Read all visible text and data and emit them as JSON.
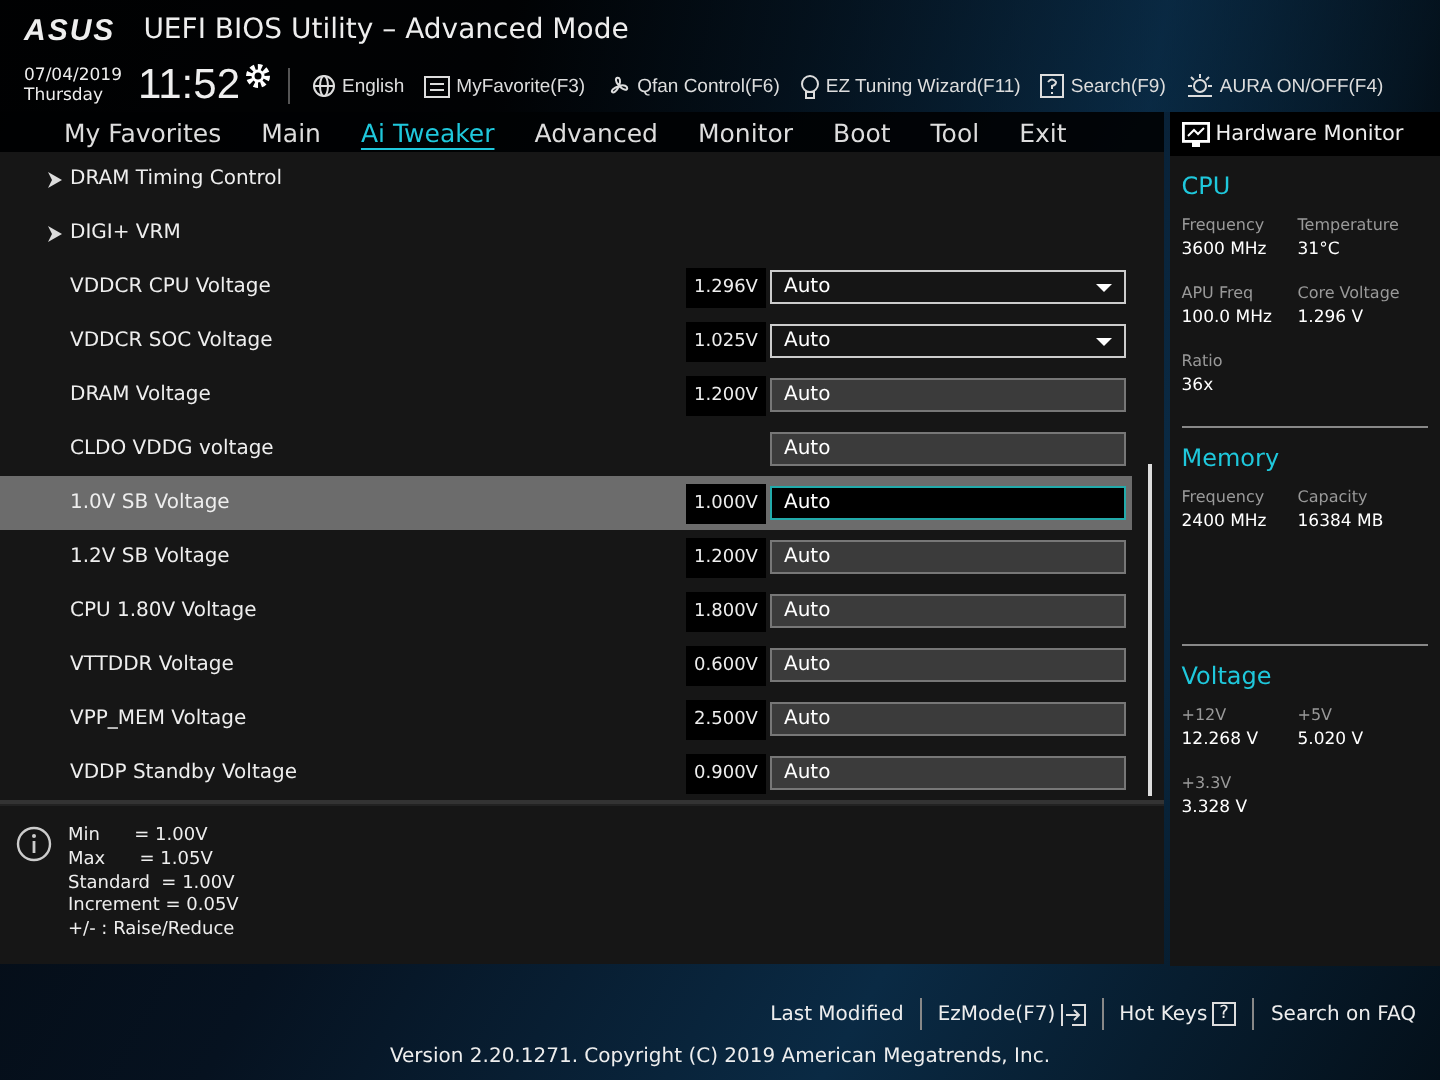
{
  "header": {
    "logo": "ASUS",
    "title": "UEFI BIOS Utility – Advanced Mode",
    "date": "07/04/2019",
    "day": "Thursday",
    "time": "11:52"
  },
  "toolbar": [
    {
      "kind": "globe",
      "label": "English"
    },
    {
      "kind": "favorite",
      "label": "MyFavorite(F3)"
    },
    {
      "kind": "fan",
      "label": "Qfan Control(F6)"
    },
    {
      "kind": "bulb",
      "label": "EZ Tuning Wizard(F11)"
    },
    {
      "kind": "search",
      "label": "Search(F9)"
    },
    {
      "kind": "aura",
      "label": "AURA ON/OFF(F4)"
    }
  ],
  "tabs": [
    {
      "label": "My Favorites",
      "selected": false
    },
    {
      "label": "Main",
      "selected": false
    },
    {
      "label": "Ai Tweaker",
      "selected": true
    },
    {
      "label": "Advanced",
      "selected": false
    },
    {
      "label": "Monitor",
      "selected": false
    },
    {
      "label": "Boot",
      "selected": false
    },
    {
      "label": "Tool",
      "selected": false
    },
    {
      "label": "Exit",
      "selected": false
    }
  ],
  "settings": [
    {
      "kind": "submenu",
      "label": "DRAM Timing Control",
      "selected": false
    },
    {
      "kind": "submenu",
      "label": "DIGI+ VRM",
      "selected": false
    },
    {
      "kind": "dropdown",
      "label": "VDDCR CPU Voltage",
      "reading": "1.296V",
      "value": "Auto",
      "selected": false
    },
    {
      "kind": "dropdown",
      "label": "VDDCR SOC Voltage",
      "reading": "1.025V",
      "value": "Auto",
      "selected": false
    },
    {
      "kind": "input",
      "label": "DRAM Voltage",
      "reading": "1.200V",
      "value": "Auto",
      "selected": false
    },
    {
      "kind": "input",
      "label": "CLDO VDDG voltage",
      "value": "Auto",
      "selected": false
    },
    {
      "kind": "input",
      "label": "1.0V SB Voltage",
      "reading": "1.000V",
      "value": "Auto",
      "selected": true
    },
    {
      "kind": "input",
      "label": "1.2V SB Voltage",
      "reading": "1.200V",
      "value": "Auto",
      "selected": false
    },
    {
      "kind": "input",
      "label": "CPU 1.80V Voltage",
      "reading": "1.800V",
      "value": "Auto",
      "selected": false
    },
    {
      "kind": "input",
      "label": "VTTDDR Voltage",
      "reading": "0.600V",
      "value": "Auto",
      "selected": false
    },
    {
      "kind": "input",
      "label": "VPP_MEM Voltage",
      "reading": "2.500V",
      "value": "Auto",
      "selected": false
    },
    {
      "kind": "input",
      "label": "VDDP Standby Voltage",
      "reading": "0.900V",
      "value": "Auto",
      "selected": false
    }
  ],
  "help": [
    "Min      = 1.00V",
    "Max      = 1.05V",
    "Standard  = 1.00V",
    "Increment = 0.05V",
    "+/- : Raise/Reduce"
  ],
  "hardware_monitor": {
    "title": "Hardware Monitor",
    "sections": [
      {
        "title": "CPU",
        "items": [
          {
            "label": "Frequency",
            "value": "3600 MHz"
          },
          {
            "label": "Temperature",
            "value": "31°C"
          },
          {
            "label": "APU Freq",
            "value": "100.0 MHz"
          },
          {
            "label": "Core Voltage",
            "value": "1.296 V"
          },
          {
            "label": "Ratio",
            "value": "36x"
          }
        ]
      },
      {
        "title": "Memory",
        "items": [
          {
            "label": "Frequency",
            "value": "2400 MHz"
          },
          {
            "label": "Capacity",
            "value": "16384 MB"
          }
        ]
      },
      {
        "title": "Voltage",
        "items": [
          {
            "label": "+12V",
            "value": "12.268 V"
          },
          {
            "label": "+5V",
            "value": "5.020 V"
          },
          {
            "label": "+3.3V",
            "value": "3.328 V"
          }
        ]
      }
    ]
  },
  "footer": {
    "links": [
      {
        "kind": "text",
        "label": "Last Modified"
      },
      {
        "kind": "ezmode",
        "label": "EzMode(F7)"
      },
      {
        "kind": "hotkeys",
        "label": "Hot Keys",
        "key": "?"
      },
      {
        "kind": "text",
        "label": "Search on FAQ"
      }
    ],
    "version": "Version 2.20.1271. Copyright (C) 2019 American Megatrends, Inc."
  }
}
